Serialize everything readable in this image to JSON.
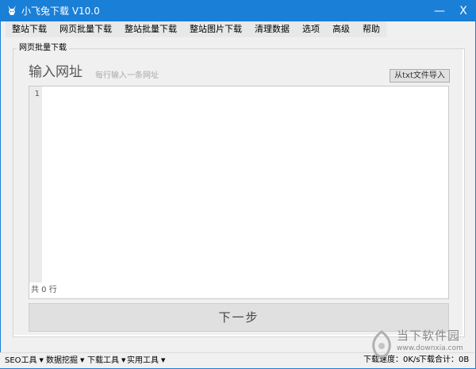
{
  "window": {
    "title": "小飞兔下载 V10.0",
    "minimize_label": "—",
    "close_label": "X",
    "accent": "#1a7fd6"
  },
  "menu": {
    "items": [
      {
        "label": "整站下载"
      },
      {
        "label": "网页批量下载"
      },
      {
        "label": "整站批量下载"
      },
      {
        "label": "整站图片下载"
      },
      {
        "label": "清理数据"
      },
      {
        "label": "选项"
      },
      {
        "label": "高级"
      },
      {
        "label": "帮助"
      }
    ]
  },
  "panel": {
    "group_title": "网页批量下载",
    "heading": "输入网址",
    "hint": "每行输入一条网址",
    "import_button": "从txt文件导入",
    "editor": {
      "line_number": "1",
      "value": ""
    },
    "line_count": "共 0 行",
    "next_button": "下一步"
  },
  "bottom": {
    "tools": [
      {
        "label": "SEO工具",
        "icon": "triangle-down-icon"
      },
      {
        "label": "数据挖掘",
        "icon": "triangle-down-icon"
      },
      {
        "label": "下载工具",
        "icon": "triangle-down-icon"
      },
      {
        "label": "实用工具",
        "icon": "triangle-down-icon"
      }
    ],
    "speed": "下载速度：0K/s",
    "total": "下载合计：0B"
  },
  "watermark": {
    "text": "当下软件园",
    "url": "www.downxia.com"
  }
}
